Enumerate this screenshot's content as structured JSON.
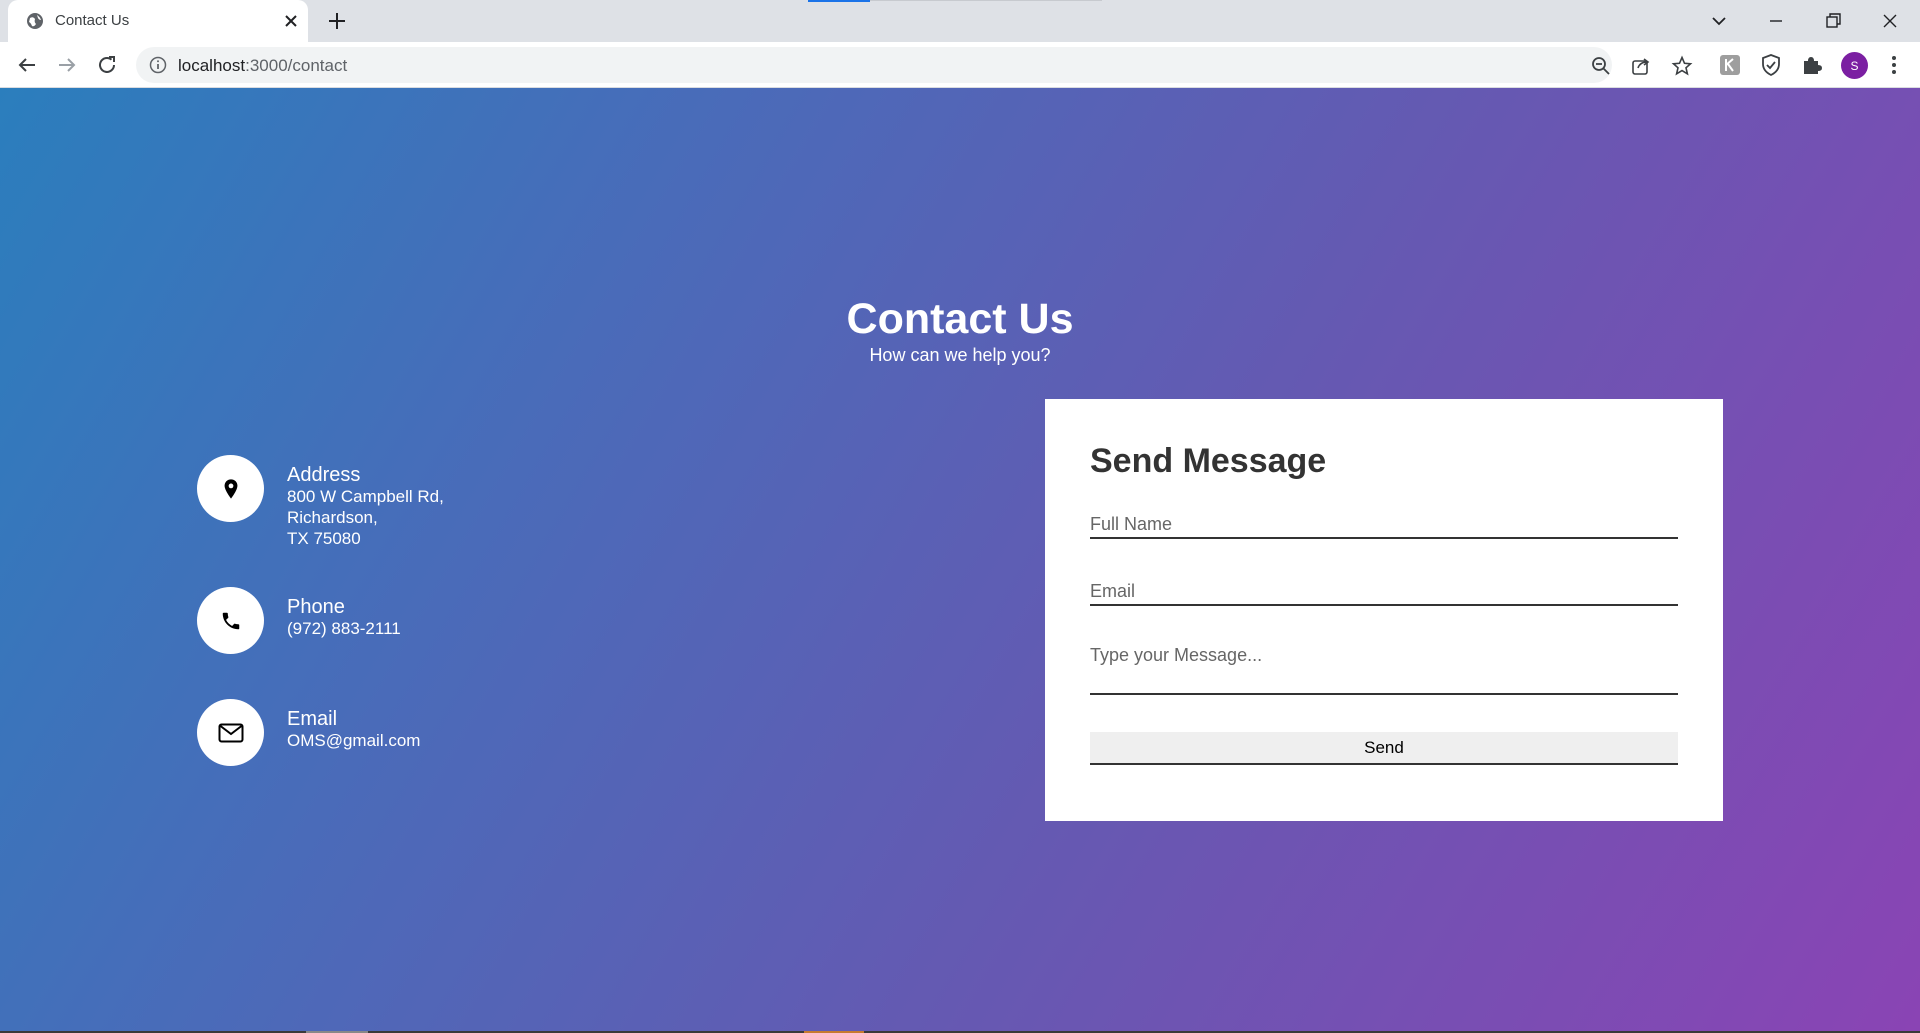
{
  "browser": {
    "tab_title": "Contact Us",
    "url_host": "localhost",
    "url_path": ":3000/contact",
    "profile_initial": "S"
  },
  "page": {
    "title": "Contact Us",
    "subtitle": "How can we help you?",
    "contact_items": [
      {
        "label": "Address",
        "value": "800 W Campbell Rd,\nRichardson,\nTX 75080",
        "icon": "location-pin-icon"
      },
      {
        "label": "Phone",
        "value": "(972) 883-2111",
        "icon": "phone-icon"
      },
      {
        "label": "Email",
        "value": "OMS@gmail.com",
        "icon": "envelope-icon"
      }
    ],
    "form": {
      "title": "Send Message",
      "name_placeholder": "Full Name",
      "email_placeholder": "Email",
      "message_placeholder": "Type your Message...",
      "send_label": "Send"
    }
  },
  "colors": {
    "gradient_start": "#2b7ebd",
    "gradient_end": "#8a44b4",
    "avatar": "#7b1fa2"
  }
}
